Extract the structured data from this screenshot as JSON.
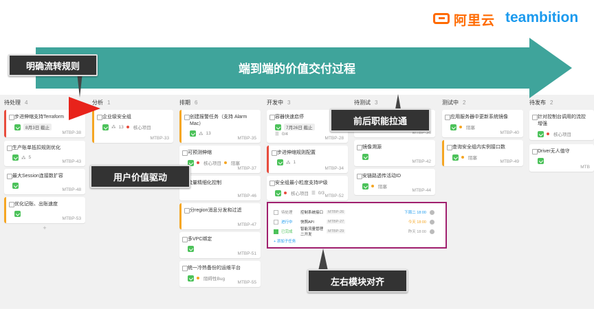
{
  "logos": {
    "aliyun": "阿里云",
    "teambition": "teambition"
  },
  "banner": {
    "title": "端到端的价值交付过程",
    "color": "#2f9c92"
  },
  "callouts": {
    "flow_rules": "明确流转规则",
    "user_value": "用户价值驱动",
    "collaboration": "前后职能拉通",
    "alignment": "左右模块对齐"
  },
  "columns": [
    {
      "name": "待处理",
      "count": "4",
      "add": "+"
    },
    {
      "name": "分析",
      "count": "1"
    },
    {
      "name": "排期",
      "count": "6"
    },
    {
      "name": "开发中",
      "count": "3"
    },
    {
      "name": "待测试",
      "count": "3"
    },
    {
      "name": "测试中",
      "count": "2"
    },
    {
      "name": "待发布",
      "count": "2"
    }
  ],
  "cards": {
    "c0": [
      {
        "title": "步进伸缩支持Terraform",
        "tag": "8月3日 截止",
        "code": "MTBP-38"
      },
      {
        "title": "生产账单抵扣规则优化",
        "sub": "5",
        "code": "MTBP-43"
      },
      {
        "title": "最大Session连接数扩容",
        "code": "MTBP-48"
      },
      {
        "title": "优化记账、出账速度",
        "code": "MTBP-53"
      }
    ],
    "c1": [
      {
        "title": "企业级安全组",
        "sub": "13",
        "label": "核心项目",
        "code": "MTBP-33"
      }
    ],
    "c2": [
      {
        "title": "创建报警任务（支持 Alarm Mac）",
        "sub": "13",
        "code": "MTBP-35"
      },
      {
        "title": "可预测伸缩",
        "label": "核心项目",
        "label2": "阻塞",
        "code": "MTBP-37"
      },
      {
        "title": "流量精细化控制",
        "code": "MTBP-46"
      },
      {
        "title": "分region消息分发和过滤",
        "code": "MTBP-47"
      },
      {
        "title": "多VPC绑定",
        "code": "MTBP-51"
      },
      {
        "title": "统一冷热备份的运维平台",
        "label": "阻碍性Bug",
        "code": "MTBP-55"
      }
    ],
    "c3": [
      {
        "title": "容器快速启停",
        "tag": "7月26日 截止",
        "sub": "0/4",
        "code": "MTBP-28"
      },
      {
        "title": "步进伸缩规则配置",
        "sub": "1",
        "code": "MTBP-34"
      },
      {
        "title": "安全组最小粒度支持IP级",
        "label": "核心项目",
        "sub": "0/3",
        "code": "MTBP-52"
      }
    ],
    "c4": [
      {
        "title": "",
        "code": "MTBP-36"
      },
      {
        "title": "镜像溯源",
        "code": "MTBP-42"
      },
      {
        "title": "安链路透传活动ID",
        "label": "阻塞",
        "code": "MTBP-44"
      }
    ],
    "c5": [
      {
        "title": "应用服务器中更新系统镜像",
        "label": "阻塞",
        "code": "MTBP-40"
      },
      {
        "title": "查询安全组内实例接口数",
        "label": "阻塞",
        "code": "MTBP-49"
      }
    ],
    "c6": [
      {
        "title": "针对控制台调用的流控增强",
        "label": "核心项目",
        "code": ""
      },
      {
        "title": "Driver无人值守",
        "code": "MTB"
      }
    ]
  },
  "subtasks": {
    "rows": [
      {
        "status": "待处理",
        "name": "控制系统接口",
        "code": "MTBP-26",
        "date": "下周二 18:00",
        "date_color": "#1b9aee"
      },
      {
        "status": "进行中",
        "name": "快照API",
        "code": "MTBP-27",
        "date": "今天 18:00",
        "date_color": "#f5a623"
      },
      {
        "status": "已完成",
        "name": "智能流量管理二开发",
        "code": "MTBP-29",
        "date": "昨天 18:00",
        "date_color": "#999999"
      }
    ],
    "add_label": "+ 添加子任务"
  }
}
